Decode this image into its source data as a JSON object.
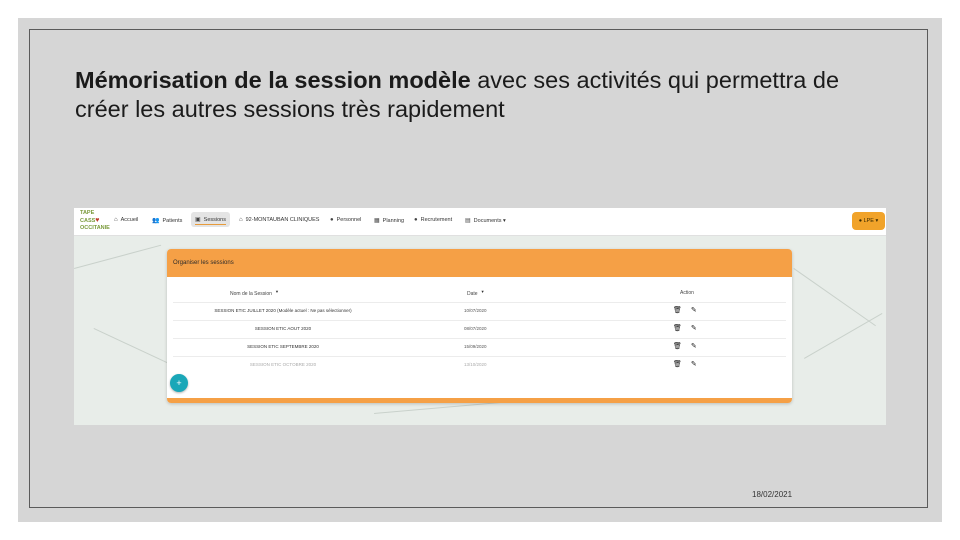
{
  "slide": {
    "title_bold": "Mémorisation de la session modèle",
    "title_rest": " avec ses activités qui permettra de créer les autres sessions très rapidement",
    "date": "18/02/2021"
  },
  "app": {
    "logo_lines": [
      "TAPE",
      "CASS",
      "OCCITANIE"
    ],
    "nav": [
      {
        "label": "Accueil",
        "icon": "home-icon"
      },
      {
        "label": "Patients",
        "icon": "users-icon"
      },
      {
        "label": "Sessions",
        "icon": "briefcase-icon"
      },
      {
        "label": "92-MONTAUBAN CLINIQUES",
        "icon": "bank-icon"
      },
      {
        "label": "Personnel",
        "icon": "user-icon"
      },
      {
        "label": "Planning",
        "icon": "calendar-icon"
      },
      {
        "label": "Recrutement",
        "icon": "person-add-icon"
      },
      {
        "label": "Documents",
        "icon": "document-icon"
      }
    ],
    "user_label": "LPE",
    "card_title": "Organiser les sessions",
    "columns": {
      "name": "Nom de la Session",
      "date": "Date",
      "action": "Action"
    },
    "rows": [
      {
        "name": "SESSION ETIC JUILLET 2020 (Modèle actuel : Ne pas sélectionner)",
        "date": "10/07/2020"
      },
      {
        "name": "SESSION ETIC AOUT 2020",
        "date": "08/07/2020"
      },
      {
        "name": "SESSION ETIC SEPTEMBRE 2020",
        "date": "15/09/2020"
      },
      {
        "name": "SESSION ETIC OCTOBRE 2020",
        "date": "13/10/2020"
      }
    ],
    "fab_label": "+"
  },
  "colors": {
    "accent": "#f5a046",
    "fab": "#1aa7b8",
    "user_button": "#f1a32a"
  }
}
